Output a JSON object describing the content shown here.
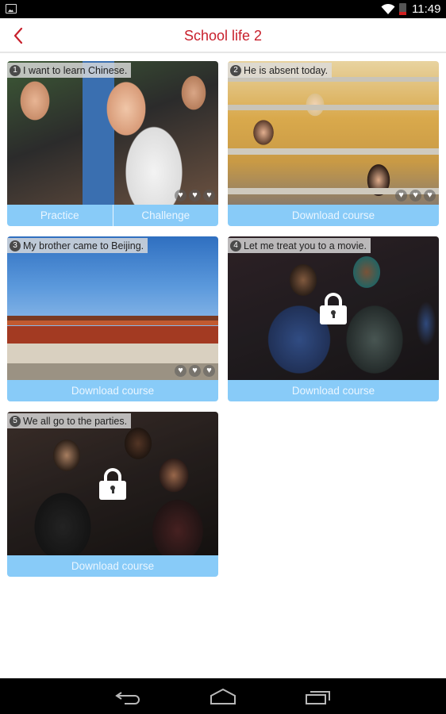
{
  "status_bar": {
    "time": "11:49",
    "icons": [
      "image-notification-icon",
      "wifi-icon",
      "battery-low-icon"
    ]
  },
  "app_bar": {
    "back_icon": "chevron-left-icon",
    "title": "School life 2"
  },
  "colors": {
    "title": "#c8202c",
    "button_bg": "#88cbf8",
    "button_text": "#eaf6ff"
  },
  "lessons": [
    {
      "number": "1",
      "title": "I want to learn Chinese.",
      "hearts": 3,
      "locked": false,
      "buttons": [
        "Practice",
        "Challenge"
      ]
    },
    {
      "number": "2",
      "title": "He is absent today.",
      "hearts": 3,
      "locked": false,
      "buttons": [
        "Download course"
      ]
    },
    {
      "number": "3",
      "title": "My brother came to Beijing.",
      "hearts": 3,
      "locked": false,
      "buttons": [
        "Download course"
      ]
    },
    {
      "number": "4",
      "title": "Let me treat you to a movie.",
      "hearts": 0,
      "locked": true,
      "buttons": [
        "Download course"
      ]
    },
    {
      "number": "5",
      "title": "We all go to the parties.",
      "hearts": 0,
      "locked": true,
      "buttons": [
        "Download course"
      ]
    }
  ],
  "nav_bar": {
    "icons": [
      "back-icon",
      "home-icon",
      "recent-apps-icon"
    ]
  }
}
